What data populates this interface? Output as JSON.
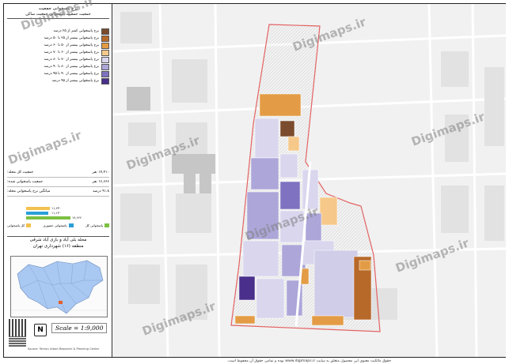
{
  "legend": {
    "title": "نرخ پاسخوانی جمعیت",
    "subtitle": "جمعیت جمعیت پاسخوانی جمعیت ساکن",
    "items": [
      {
        "label": "نرخ پاسخوانی کمتر از ۲۵ درصد",
        "color": "#7a4b2c"
      },
      {
        "label": "نرخ پاسخوانی بیشتر از ۲۵ تا ۵۰ درصد",
        "color": "#b7692a"
      },
      {
        "label": "نرخ پاسخوانی بیشتر از ۵۰ تا ۶۰ درصد",
        "color": "#e39c45"
      },
      {
        "label": "نرخ پاسخوانی بیشتر از ۶۰ تا ۷۰ درصد",
        "color": "#f6c98a"
      },
      {
        "label": "نرخ پاسخوانی بیشتر از ۷۰ تا ۸۰ درصد",
        "color": "#d9d6ee"
      },
      {
        "label": "نرخ پاسخوانی بیشتر از ۸۰ تا ۹۰ درصد",
        "color": "#aca6d9"
      },
      {
        "label": "نرخ پاسخوانی بیشتر از ۹۰ تا ۹۵ درصد",
        "color": "#7e72c1"
      },
      {
        "label": "نرخ پاسخوانی بیشتر از ۹۵ درصد",
        "color": "#4a2f8c"
      }
    ]
  },
  "stats": [
    {
      "label": "جمعیت کل محله:",
      "value": "۱۷,۴۱۰ نفر"
    },
    {
      "label": "جمعیت پاسخوانی شده:",
      "value": "۱۶,۶۶۶ نفر"
    },
    {
      "label": "میانگین نرخ پاسخوانی محله:",
      "value": "۹۱.۸ درصد"
    }
  ],
  "bar_chart": {
    "values": [
      "۱۱,۶۳۰",
      "۱۱,۱۳۰",
      "۱۴,۶۶۶"
    ],
    "colors": [
      "#f2c14e",
      "#2a9fd6",
      "#7cc042"
    ],
    "categories": [
      "کل پاسخوانی",
      "پاسخوانی حضوری",
      "پاسخوانی کل"
    ]
  },
  "place": {
    "name": "محله بلی آباد و بازی آباد شرقی",
    "district": "منطقه (۱۶) شهرداری تهران"
  },
  "scale_text": "Scale = 1:9,000",
  "credit": "Source: Tehran Urban Research & Planning Center",
  "north_symbol": "N",
  "bottom_note": "حقوق مالکیت معنوی این محصول متعلق به سایت www.digimaps.ir بوده و تمامی حقوق آن محفوظ است.",
  "watermark": "Digimaps.ir"
}
